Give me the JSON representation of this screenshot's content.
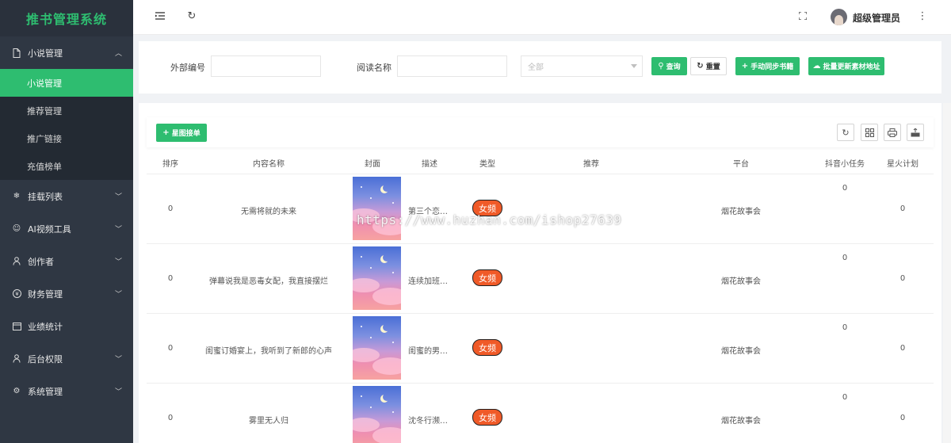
{
  "app": {
    "title": "推书管理系统"
  },
  "sidebar": {
    "groups": [
      {
        "label": "小说管理",
        "icon": "file-icon",
        "open": true,
        "items": [
          {
            "label": "小说管理",
            "active": true
          },
          {
            "label": "推荐管理"
          },
          {
            "label": "推广链接"
          },
          {
            "label": "充值榜单"
          }
        ]
      },
      {
        "label": "挂载列表",
        "icon": "snowflake-icon"
      },
      {
        "label": "AI视频工具",
        "icon": "smile-icon"
      },
      {
        "label": "创作者",
        "icon": "user-icon"
      },
      {
        "label": "财务管理",
        "icon": "yen-icon"
      },
      {
        "label": "业绩统计",
        "icon": "calendar-icon"
      },
      {
        "label": "后台权限",
        "icon": "user-icon"
      },
      {
        "label": "系统管理",
        "icon": "gear-icon"
      }
    ]
  },
  "header": {
    "username": "超级管理员"
  },
  "search": {
    "external_id_label": "外部编号",
    "external_id_value": "",
    "read_name_label": "阅读名称",
    "read_name_value": "",
    "select_placeholder": "全部",
    "query_label": "查询",
    "reset_label": "重置",
    "sync_label": "手动同步书籍",
    "batch_label": "批量更新素材地址"
  },
  "toolbar": {
    "add_label": "星图接单"
  },
  "table": {
    "columns": [
      "排序",
      "内容名称",
      "封面",
      "描述",
      "类型",
      "推荐",
      "平台",
      "抖音小任务",
      "星火计划"
    ],
    "rows": [
      {
        "order": "0",
        "name": "无需将就的未来",
        "desc": "第三个恋…",
        "type": "女频",
        "platform": "烟花故事会",
        "douyin": "0",
        "spark": "0"
      },
      {
        "order": "0",
        "name": "弹幕说我是恶毒女配，我直接摆烂",
        "desc": "连续加班…",
        "type": "女频",
        "platform": "烟花故事会",
        "douyin": "0",
        "spark": "0"
      },
      {
        "order": "0",
        "name": "闺蜜订婚宴上，我听到了新郎的心声",
        "desc": "闺蜜的男…",
        "type": "女频",
        "platform": "烟花故事会",
        "douyin": "0",
        "spark": "0"
      },
      {
        "order": "0",
        "name": "雾里无人归",
        "desc": "沈冬行濒…",
        "type": "女频",
        "platform": "烟花故事会",
        "douyin": "0",
        "spark": "0"
      }
    ]
  },
  "watermark": "https://www.huzhan.com/ishop27639",
  "colors": {
    "accent": "#2ebd70",
    "sidebar": "#2f3743",
    "tag": "#f05a28"
  }
}
